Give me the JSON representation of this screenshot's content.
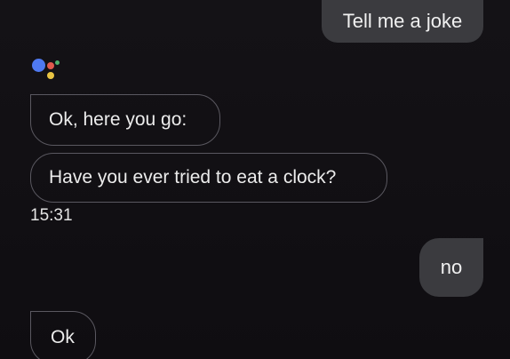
{
  "messages": {
    "user_1": "Tell me a joke",
    "assistant_1": "Ok, here you go:",
    "assistant_2": "Have you ever tried to eat a clock?",
    "timestamp": "15:31",
    "user_2": "no",
    "assistant_3": "Ok"
  },
  "colors": {
    "background": "#110f13",
    "user_bubble": "#3b3b3f",
    "assistant_border": "#5a5860",
    "logo_blue": "#4f79f0",
    "logo_red": "#e05a4d",
    "logo_yellow": "#e9c443",
    "logo_green": "#4caf6c"
  },
  "icons": {
    "assistant_logo": "assistant-logo-icon"
  }
}
